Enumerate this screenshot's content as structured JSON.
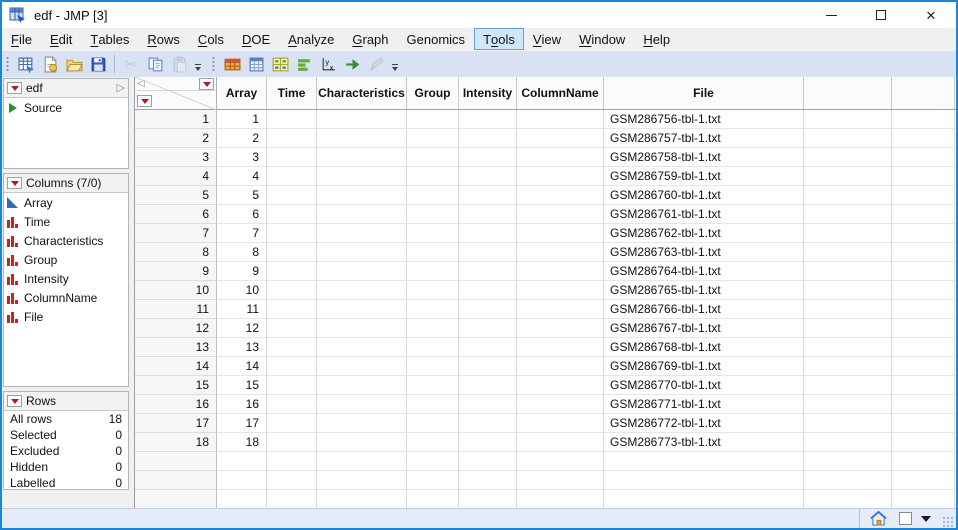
{
  "window": {
    "title": "edf - JMP [3]",
    "controls": [
      "minimize",
      "maximize",
      "close"
    ]
  },
  "colors": {
    "accent_border": "#1a86d9",
    "menu_highlight_bg": "#cfe7fb",
    "menu_highlight_border": "#66a0cc",
    "toolbar_bg": "#d9e2f3",
    "red_triangle": "#b01f24",
    "continuous_icon": "#2e6db4",
    "nominal_icon": "#c2261f",
    "statusbar_bg": "#e5ebf7"
  },
  "menu_bar": {
    "active": "Tools",
    "items": [
      {
        "label": "File",
        "underline": 0
      },
      {
        "label": "Edit",
        "underline": 0
      },
      {
        "label": "Tables",
        "underline": 0
      },
      {
        "label": "Rows",
        "underline": 0
      },
      {
        "label": "Cols",
        "underline": 0
      },
      {
        "label": "DOE",
        "underline": 0
      },
      {
        "label": "Analyze",
        "underline": 0
      },
      {
        "label": "Graph",
        "underline": 0
      },
      {
        "label": "Genomics",
        "underline": -1
      },
      {
        "label": "Tools",
        "underline": 1
      },
      {
        "label": "View",
        "underline": 0
      },
      {
        "label": "Window",
        "underline": 0
      },
      {
        "label": "Help",
        "underline": 0
      }
    ]
  },
  "toolbar": {
    "group1": [
      {
        "icon": "new-data-table",
        "enabled": true
      },
      {
        "icon": "import-data",
        "enabled": true
      },
      {
        "icon": "open",
        "enabled": true
      },
      {
        "icon": "save",
        "enabled": true
      },
      {
        "icon": "separator"
      },
      {
        "icon": "cut",
        "enabled": false
      },
      {
        "icon": "copy",
        "enabled": true
      },
      {
        "icon": "paste",
        "enabled": false
      }
    ],
    "group2": [
      {
        "icon": "data-table",
        "enabled": true
      },
      {
        "icon": "summary",
        "enabled": true
      },
      {
        "icon": "split-columns",
        "enabled": true
      },
      {
        "icon": "distribution",
        "enabled": true
      },
      {
        "icon": "fit-y-by-x",
        "enabled": true
      },
      {
        "icon": "run-script",
        "enabled": true
      },
      {
        "icon": "edit-script",
        "enabled": false
      }
    ]
  },
  "sidebar": {
    "table_panel": {
      "title": "edf",
      "items": [
        {
          "label": "Source"
        }
      ]
    },
    "columns_panel": {
      "title": "Columns (7/0)",
      "items": [
        {
          "name": "Array",
          "type": "continuous"
        },
        {
          "name": "Time",
          "type": "nominal"
        },
        {
          "name": "Characteristics",
          "type": "nominal"
        },
        {
          "name": "Group",
          "type": "nominal"
        },
        {
          "name": "Intensity",
          "type": "nominal"
        },
        {
          "name": "ColumnName",
          "type": "nominal"
        },
        {
          "name": "File",
          "type": "nominal"
        }
      ]
    },
    "rows_panel": {
      "title": "Rows",
      "stats": [
        {
          "label": "All rows",
          "value": "18"
        },
        {
          "label": "Selected",
          "value": "0"
        },
        {
          "label": "Excluded",
          "value": "0"
        },
        {
          "label": "Hidden",
          "value": "0"
        },
        {
          "label": "Labelled",
          "value": "0"
        }
      ]
    }
  },
  "table": {
    "columns": [
      "Array",
      "Time",
      "Characteristics",
      "Group",
      "Intensity",
      "ColumnName",
      "File"
    ],
    "rows": [
      {
        "n": "1",
        "Array": "1",
        "File": "GSM286756-tbl-1.txt"
      },
      {
        "n": "2",
        "Array": "2",
        "File": "GSM286757-tbl-1.txt"
      },
      {
        "n": "3",
        "Array": "3",
        "File": "GSM286758-tbl-1.txt"
      },
      {
        "n": "4",
        "Array": "4",
        "File": "GSM286759-tbl-1.txt"
      },
      {
        "n": "5",
        "Array": "5",
        "File": "GSM286760-tbl-1.txt"
      },
      {
        "n": "6",
        "Array": "6",
        "File": "GSM286761-tbl-1.txt"
      },
      {
        "n": "7",
        "Array": "7",
        "File": "GSM286762-tbl-1.txt"
      },
      {
        "n": "8",
        "Array": "8",
        "File": "GSM286763-tbl-1.txt"
      },
      {
        "n": "9",
        "Array": "9",
        "File": "GSM286764-tbl-1.txt"
      },
      {
        "n": "10",
        "Array": "10",
        "File": "GSM286765-tbl-1.txt"
      },
      {
        "n": "11",
        "Array": "11",
        "File": "GSM286766-tbl-1.txt"
      },
      {
        "n": "12",
        "Array": "12",
        "File": "GSM286767-tbl-1.txt"
      },
      {
        "n": "13",
        "Array": "13",
        "File": "GSM286768-tbl-1.txt"
      },
      {
        "n": "14",
        "Array": "14",
        "File": "GSM286769-tbl-1.txt"
      },
      {
        "n": "15",
        "Array": "15",
        "File": "GSM286770-tbl-1.txt"
      },
      {
        "n": "16",
        "Array": "16",
        "File": "GSM286771-tbl-1.txt"
      },
      {
        "n": "17",
        "Array": "17",
        "File": "GSM286772-tbl-1.txt"
      },
      {
        "n": "18",
        "Array": "18",
        "File": "GSM286773-tbl-1.txt"
      }
    ]
  },
  "status_bar": {
    "icons": [
      "home",
      "window-box",
      "dropdown"
    ]
  }
}
